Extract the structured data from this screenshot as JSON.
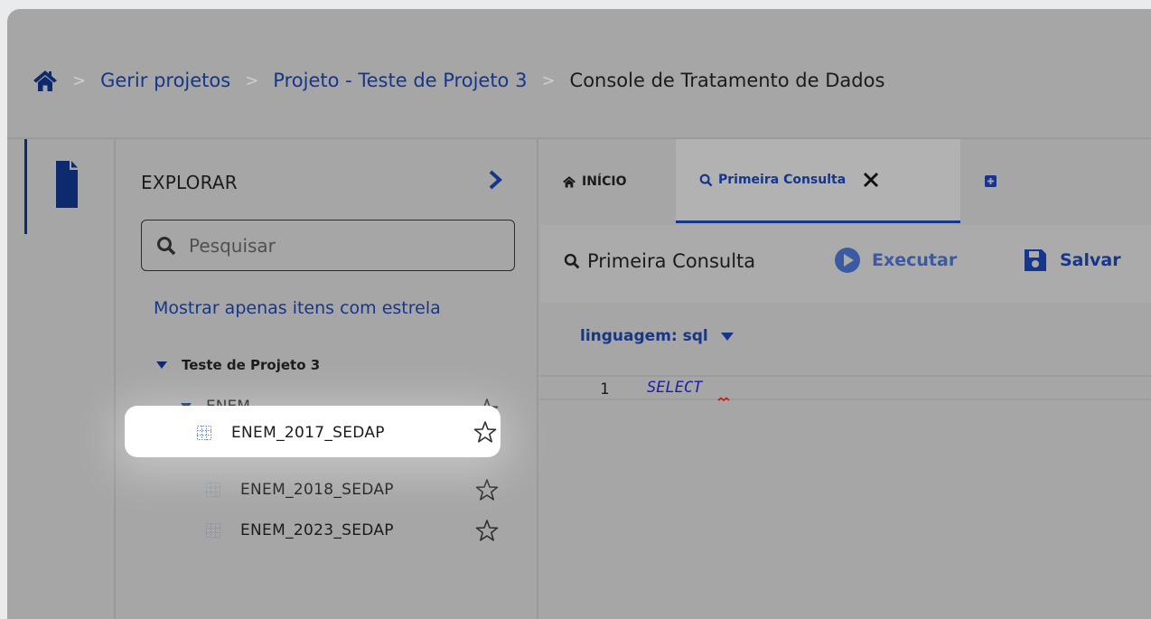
{
  "breadcrumb": {
    "home_icon": "home-icon",
    "items": [
      "Gerir projetos",
      "Projeto - Teste de Projeto 3"
    ],
    "current": "Console de Tratamento de Dados",
    "separator": ">"
  },
  "explorer": {
    "title": "EXPLORAR",
    "search_placeholder": "Pesquisar",
    "starred_filter_label": "Mostrar apenas itens com estrela",
    "project_name": "Teste de Projeto 3",
    "folder_name": "ENEM",
    "tables": [
      {
        "name": "ENEM_2017_SEDAP",
        "highlighted": true
      },
      {
        "name": "ENEM_2018_SEDAP",
        "highlighted": false
      },
      {
        "name": "ENEM_2023_SEDAP",
        "highlighted": false
      }
    ]
  },
  "tabs": {
    "home_label": "INÍCIO",
    "query_label": "Primeira Consulta"
  },
  "toolbar": {
    "query_title": "Primeira Consulta",
    "run_label": "Executar",
    "save_label": "Salvar"
  },
  "editor": {
    "language_label": "linguagem: sql",
    "lines": [
      {
        "number": "1",
        "code": "SELECT"
      }
    ]
  },
  "colors": {
    "accent": "#16368c",
    "overlay_gray": "#a6a6a6",
    "highlight": "#ffffff",
    "keyword": "#1c1ca8"
  }
}
